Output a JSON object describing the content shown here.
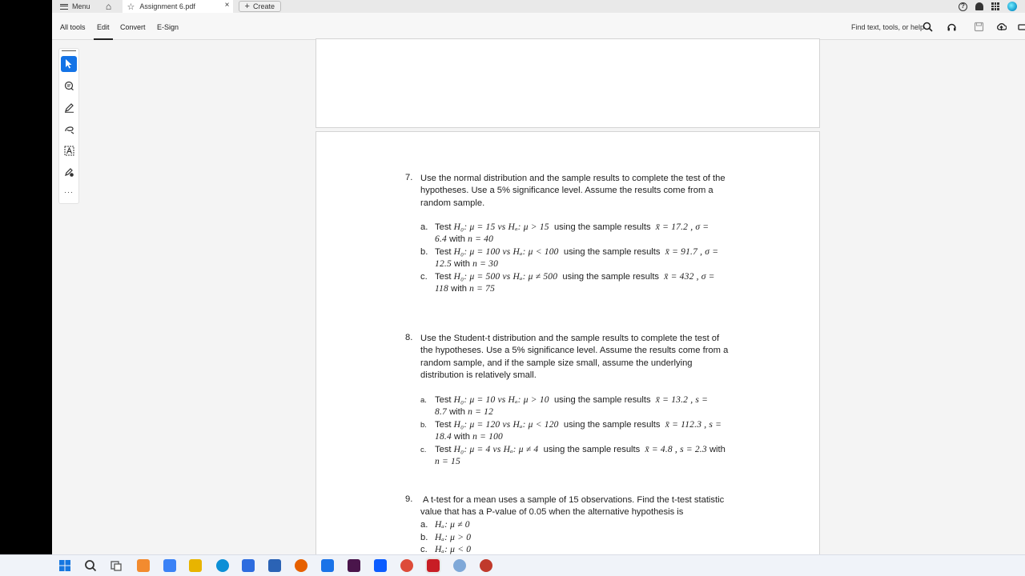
{
  "tabbar": {
    "menu_label": "Menu",
    "home_icon": "home-icon",
    "tab_title": "Assignment 6.pdf",
    "close_glyph": "×",
    "create_label": "Create"
  },
  "toolbar": {
    "tabs": [
      "All tools",
      "Edit",
      "Convert",
      "E-Sign"
    ],
    "active_tab": "Edit",
    "find_label": "Find text, tools, or help"
  },
  "rail": {
    "tools": [
      "select-icon",
      "comment-icon",
      "highlight-icon",
      "draw-icon",
      "text-select-icon",
      "stamp-icon",
      "more-icon"
    ],
    "more_glyph": "···"
  },
  "doc": {
    "q7": {
      "number": "7.",
      "lines": [
        "Use the normal distribution and the sample results to complete the test of the",
        "hypotheses. Use a 5% significance level. Assume the results come from a",
        "random sample."
      ],
      "items": [
        {
          "label": "a.",
          "line1": "Test",
          "math1": "H₀: μ = 15 vs Hₐ: μ > 15",
          "mid1": "using the sample results",
          "math1b": "x̄ = 17.2 ,  σ =",
          "line2math": "6.4",
          "line2": "with",
          "line2math2": "n = 40"
        },
        {
          "label": "b.",
          "line1": "Test",
          "math1": "H₀: μ = 100 vs Hₐ: μ < 100",
          "mid1": "using the sample results",
          "math1b": "x̄ = 91.7 ,  σ =",
          "line2math": "12.5",
          "line2": "with",
          "line2math2": "n = 30"
        },
        {
          "label": "c.",
          "line1": "Test",
          "math1": "H₀: μ = 500 vs Hₐ: μ ≠ 500",
          "mid1": "using the sample results",
          "math1b": "x̄ = 432 ,  σ =",
          "line2math": "118",
          "line2": "with",
          "line2math2": "n = 75"
        }
      ]
    },
    "q8": {
      "number": "8.",
      "lines": [
        "Use the Student-t distribution and the sample results to complete the test of",
        "the hypotheses. Use a 5% significance level. Assume the results come from a",
        "random sample, and if the sample size small, assume the underlying",
        "distribution is relatively small."
      ],
      "items": [
        {
          "label": "a.",
          "line1": "Test",
          "math1": "H₀: μ = 10 vs Hₐ: μ > 10",
          "mid1": "using the sample results",
          "math1b": "x̄ = 13.2 ,  s =",
          "line2math": "8.7",
          "line2": "with",
          "line2math2": "n = 12"
        },
        {
          "label": "b.",
          "line1": "Test",
          "math1": "H₀: μ = 120 vs Hₐ: μ < 120",
          "mid1": "using the sample results",
          "math1b": "x̄ = 112.3 ,  s =",
          "line2math": "18.4",
          "line2": "with",
          "line2math2": "n = 100"
        },
        {
          "label": "c.",
          "line1": "Test",
          "math1": "H₀: μ = 4 vs Hₐ: μ ≠ 4",
          "mid1": "using the sample results",
          "math1b": "x̄ = 4.8 ,  s = 2.3",
          "line1end": "with",
          "line2math": "",
          "line2": "",
          "line2math2": "n = 15"
        }
      ]
    },
    "q9": {
      "number": "9.",
      "lines": [
        "A t-test for a mean uses a sample of 15 observations. Find the t-test statistic",
        "value that has a P-value of 0.05 when the alternative hypothesis is"
      ],
      "items": [
        {
          "label": "a.",
          "math": "Hₐ: μ ≠ 0"
        },
        {
          "label": "b.",
          "math": "Hₐ: μ > 0"
        },
        {
          "label": "c.",
          "math": "Hₐ: μ < 0"
        }
      ]
    }
  },
  "taskbar": {
    "icons": [
      "windows-start-icon",
      "search-icon",
      "task-view-icon",
      "copilot-icon",
      "app-b-icon",
      "file-explorer-icon",
      "edge-icon",
      "app-mail-icon",
      "app-store-icon",
      "firefox-icon",
      "app-blue-icon",
      "slack-icon",
      "zoom-icon",
      "chrome-icon",
      "acrobat-icon",
      "r-icon",
      "app-red-icon"
    ],
    "colors": [
      "#1677e0",
      "#333333",
      "#555555",
      "#f28b2f",
      "#3b82f6",
      "#e8b400",
      "#0c8fd6",
      "#2d6cdf",
      "#2b63b5",
      "#e66000",
      "#1a73e8",
      "#4a154b",
      "#0b5cff",
      "#dd4b39",
      "#c81d25",
      "#7fa8d8",
      "#c0392b"
    ]
  }
}
